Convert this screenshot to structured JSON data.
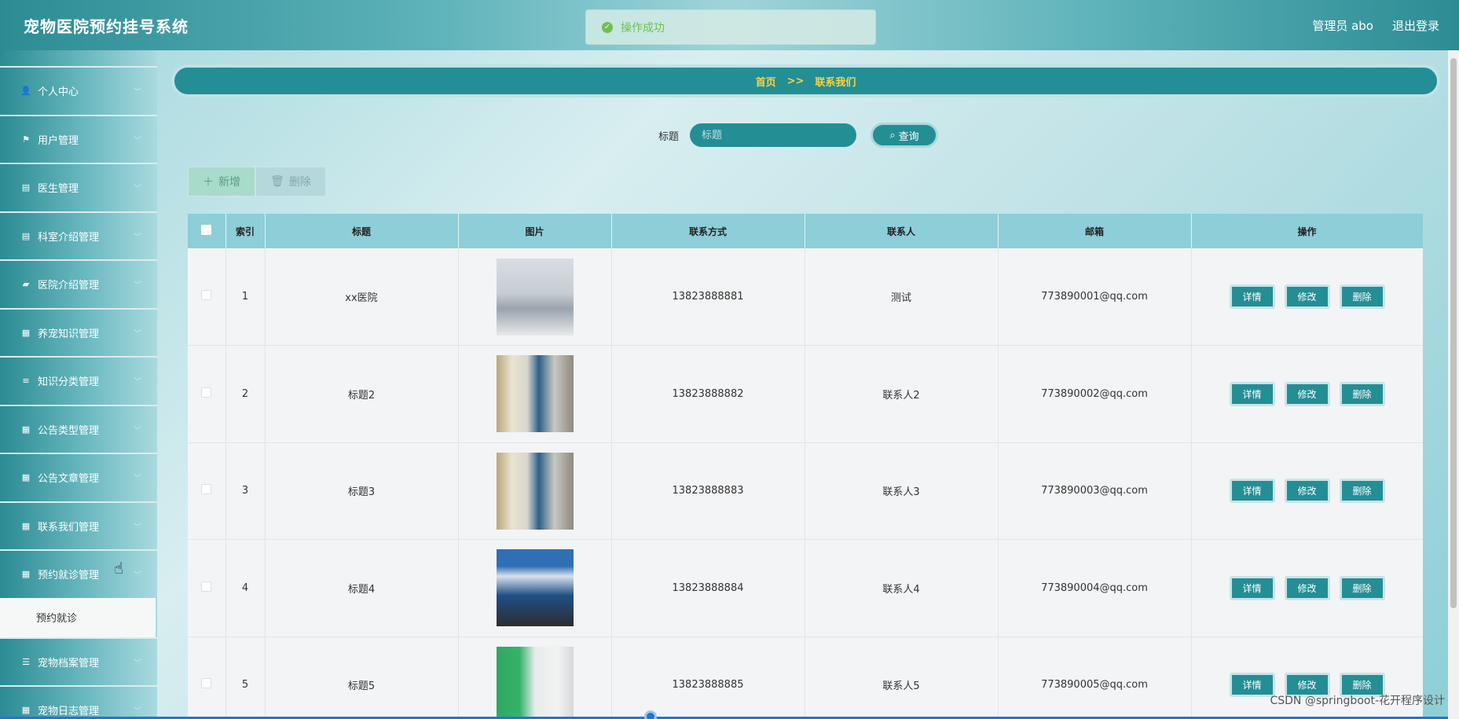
{
  "header": {
    "title": "宠物医院预约挂号系统",
    "user": "管理员 abo",
    "logout": "退出登录"
  },
  "toast": {
    "message": "操作成功"
  },
  "sidebar": {
    "items": [
      {
        "label": "个人中心",
        "icon": "user-icon"
      },
      {
        "label": "用户管理",
        "icon": "flag-icon"
      },
      {
        "label": "医生管理",
        "icon": "clipboard-icon"
      },
      {
        "label": "科室介绍管理",
        "icon": "clipboard-icon"
      },
      {
        "label": "医院介绍管理",
        "icon": "ticket-icon"
      },
      {
        "label": "养宠知识管理",
        "icon": "grid-icon"
      },
      {
        "label": "知识分类管理",
        "icon": "list-icon"
      },
      {
        "label": "公告类型管理",
        "icon": "grid-icon"
      },
      {
        "label": "公告文章管理",
        "icon": "grid-icon"
      },
      {
        "label": "联系我们管理",
        "icon": "grid-icon"
      },
      {
        "label": "预约就诊管理",
        "icon": "grid-icon"
      }
    ],
    "submenu": {
      "label": "预约就诊"
    },
    "items_after": [
      {
        "label": "宠物档案管理",
        "icon": "sliders-icon"
      },
      {
        "label": "宠物日志管理",
        "icon": "grid-icon"
      }
    ]
  },
  "breadcrumb": {
    "home": "首页",
    "sep": ">>",
    "current": "联系我们"
  },
  "search": {
    "label": "标题",
    "placeholder": "标题",
    "button": "查询"
  },
  "toolbar": {
    "add_label": "新增",
    "delete_label": "删除"
  },
  "table": {
    "headers": [
      "索引",
      "标题",
      "图片",
      "联系方式",
      "联系人",
      "邮箱",
      "操作"
    ],
    "rows": [
      {
        "index": "1",
        "title": "xx医院",
        "phone": "13823888881",
        "contact": "测试",
        "email": "773890001@qq.com"
      },
      {
        "index": "2",
        "title": "标题2",
        "phone": "13823888882",
        "contact": "联系人2",
        "email": "773890002@qq.com"
      },
      {
        "index": "3",
        "title": "标题3",
        "phone": "13823888883",
        "contact": "联系人3",
        "email": "773890003@qq.com"
      },
      {
        "index": "4",
        "title": "标题4",
        "phone": "13823888884",
        "contact": "联系人4",
        "email": "773890004@qq.com"
      },
      {
        "index": "5",
        "title": "标题5",
        "phone": "13823888885",
        "contact": "联系人5",
        "email": "773890005@qq.com"
      }
    ],
    "actions": {
      "detail": "详情",
      "edit": "修改",
      "delete": "删除"
    }
  },
  "watermark": "CSDN @springboot-花开程序设计",
  "colors": {
    "primary": "#248e95",
    "breadcrumb_text": "#f5d547",
    "header_th": "#8dced8"
  }
}
